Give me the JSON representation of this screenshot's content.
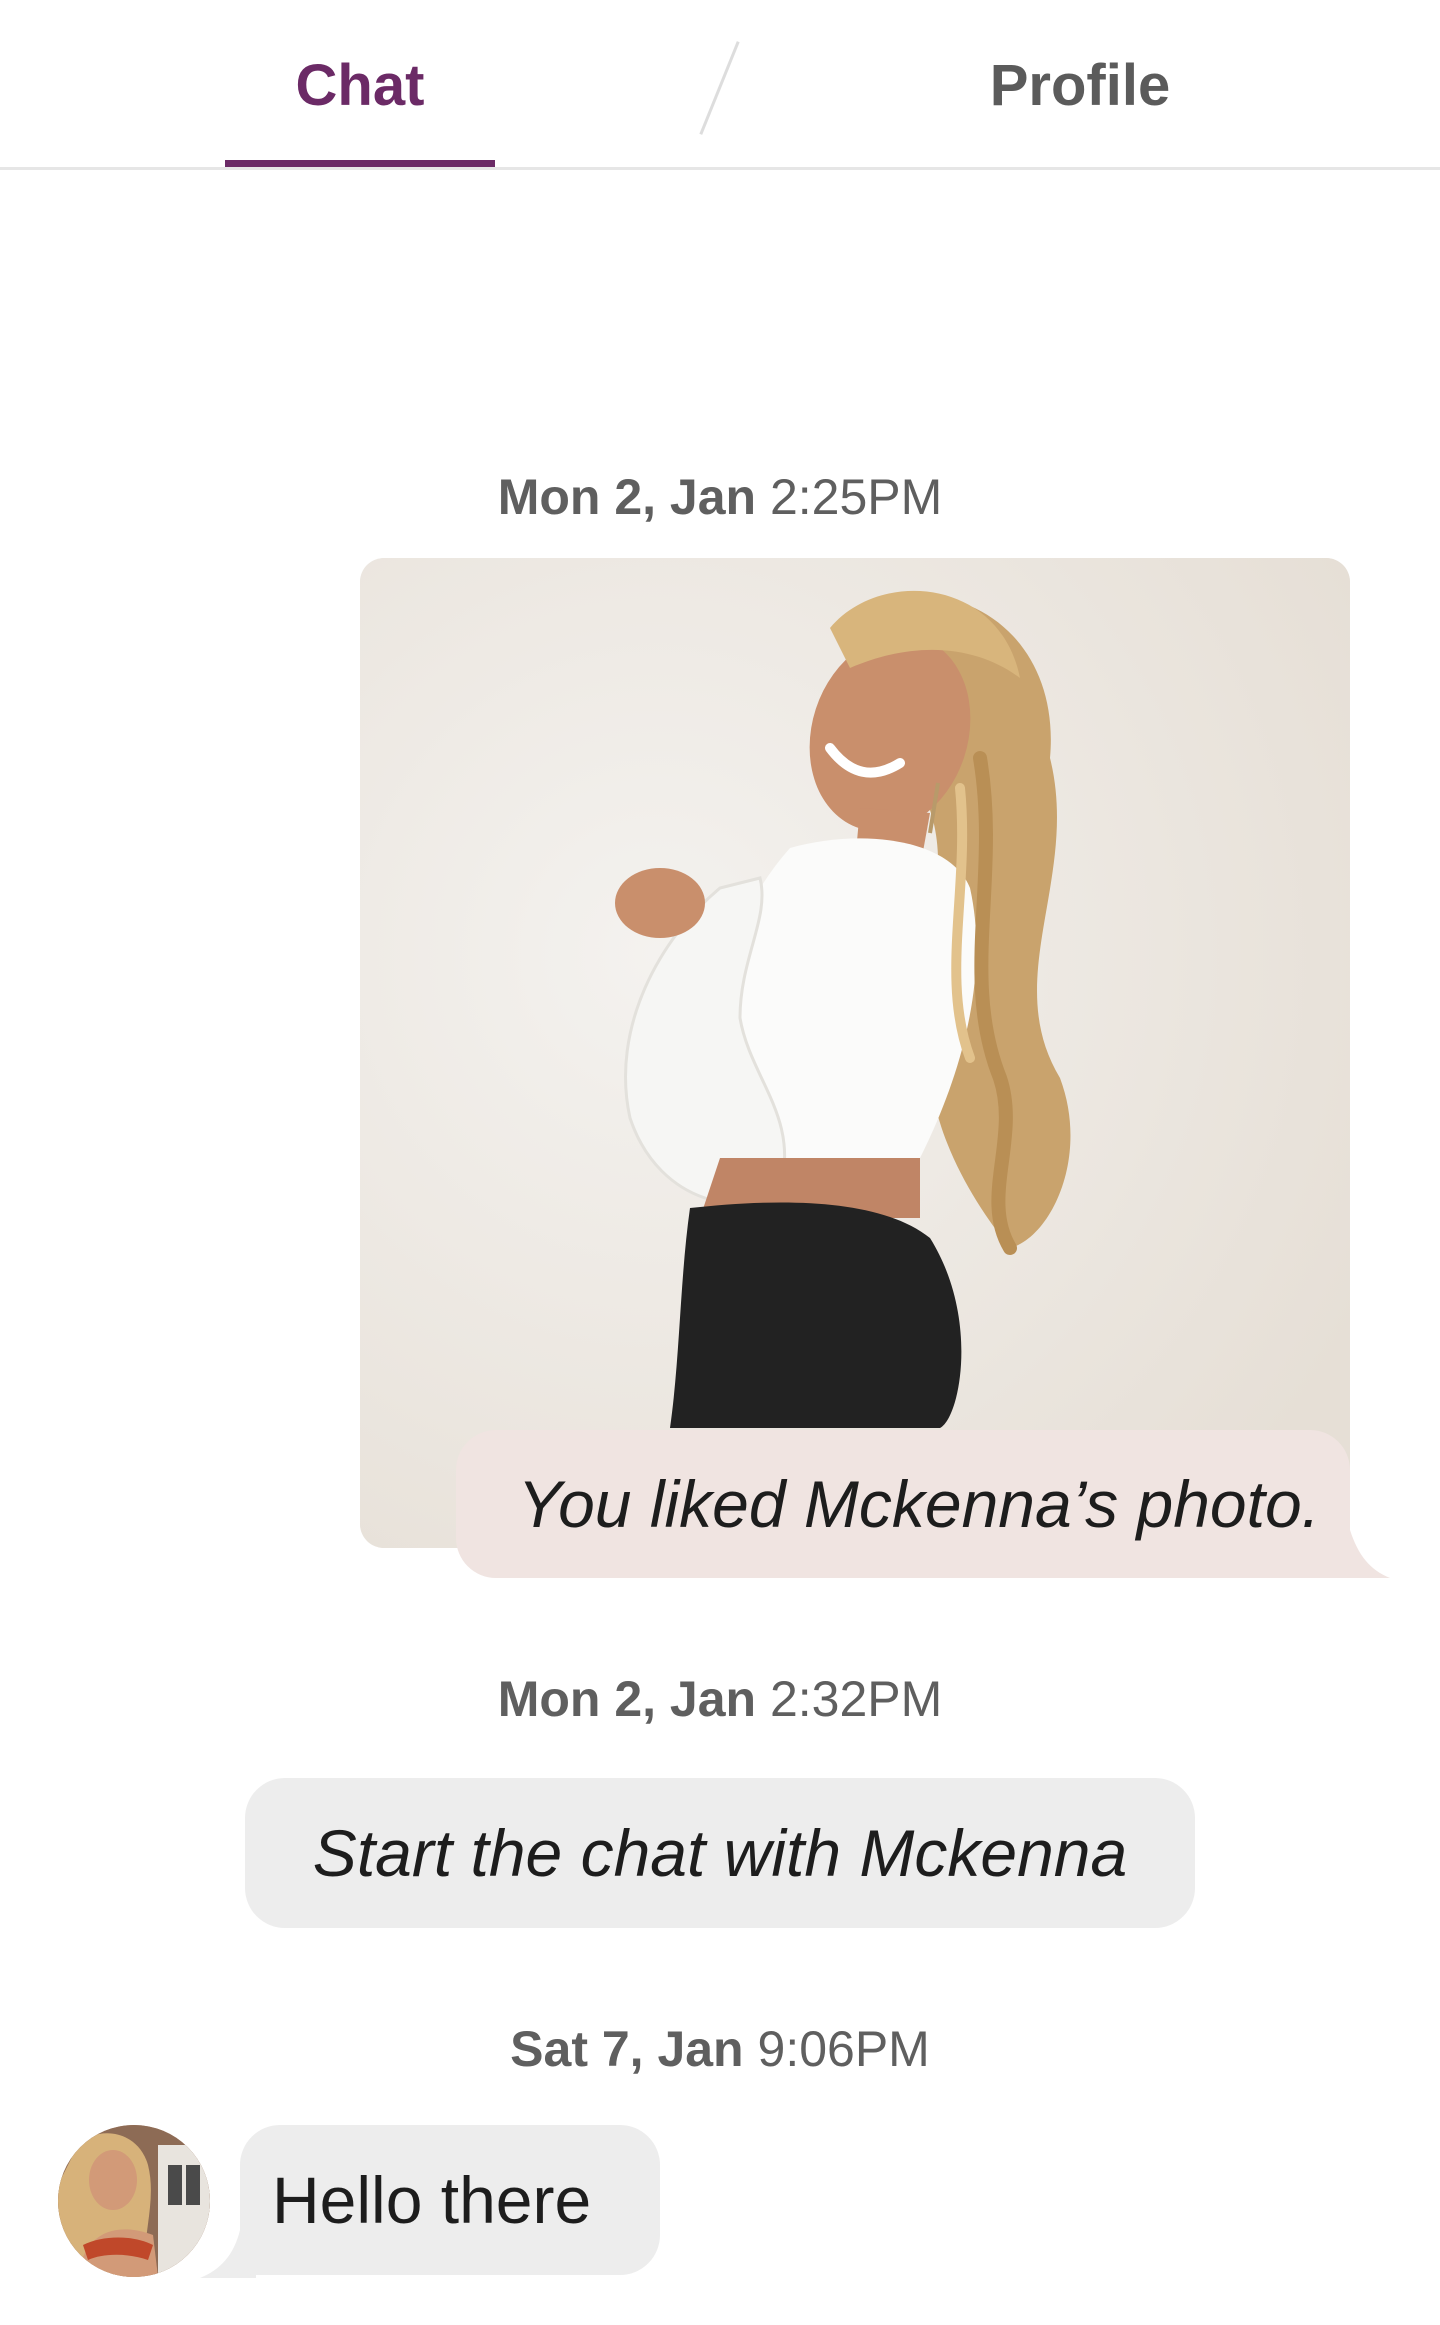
{
  "tabs": {
    "chat_label": "Chat",
    "profile_label": "Profile",
    "active": "Chat"
  },
  "colors": {
    "accent": "#6b2a66",
    "liked_bubble": "#f0e4e1",
    "system_bubble": "#ededed"
  },
  "messages": [
    {
      "date": "Mon 2, Jan",
      "time": "2:25PM",
      "type": "liked-photo",
      "text": "You liked Mckenna’s photo."
    },
    {
      "date": "Mon 2, Jan",
      "time": "2:32PM",
      "type": "system",
      "text": "Start the chat with Mckenna"
    },
    {
      "date": "Sat 7, Jan",
      "time": "9:06PM",
      "type": "incoming",
      "text": "Hello there"
    }
  ]
}
